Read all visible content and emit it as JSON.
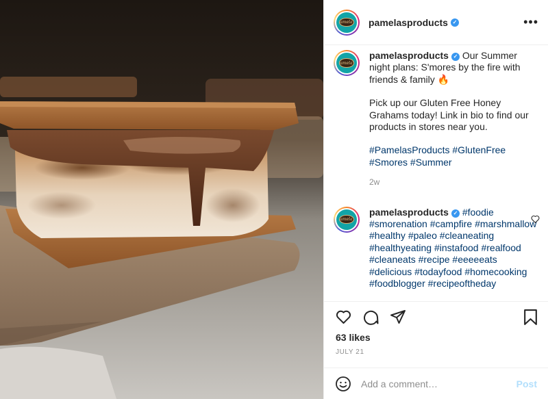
{
  "post": {
    "account": "pamelasproducts",
    "avatar_text": "Pamela's",
    "likes": "63 likes",
    "date": "JULY 21"
  },
  "caption": {
    "line1": "Our Summer night plans: S'mores by the fire with friends & family 🔥",
    "line2": "Pick up our Gluten Free Honey Grahams today! Link in bio to find our products in stores near you.",
    "hashtags": "#PamelasProducts #GlutenFree #Smores #Summer",
    "age": "2w"
  },
  "comment": {
    "text": "#foodie #smorenation #campfire #marshmallow #healthy #paleo #cleaneating #healthyeating #instafood #realfood #cleaneats #recipe #eeeeeats #delicious #todayfood #homecooking #foodblogger #recipeoftheday"
  },
  "add_comment": {
    "placeholder": "Add a comment…",
    "post_label": "Post"
  },
  "icons": {
    "more": "more-icon",
    "like": "heart-icon",
    "comment": "comment-icon",
    "share": "share-icon",
    "save": "bookmark-icon",
    "emoji": "emoji-icon",
    "verified": "verified-badge-icon"
  },
  "colors": {
    "link": "#00376b",
    "muted": "#8e8e8e",
    "verified": "#3897f0",
    "post_disabled": "#b2dffc"
  }
}
